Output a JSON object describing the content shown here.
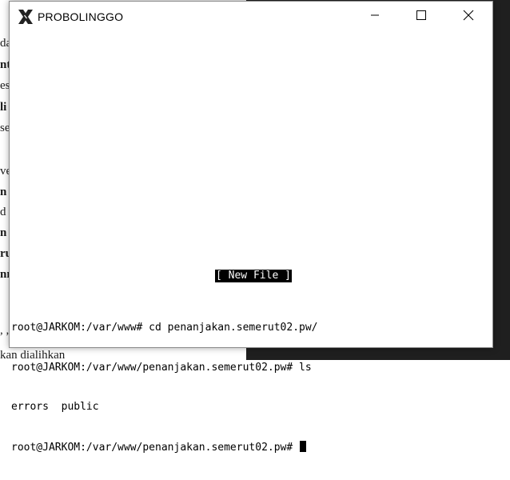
{
  "background": {
    "doc_lines": [
      {
        "text": "da",
        "bold": false
      },
      {
        "text": "nt",
        "bold": true
      },
      {
        "text": "es",
        "bold": false
      },
      {
        "text": "li",
        "bold": true
      },
      {
        "text": "se",
        "bold": false
      },
      {
        "text": "",
        "bold": false
      },
      {
        "text": "ve",
        "bold": false
      },
      {
        "text": "n",
        "bold": true
      },
      {
        "text": "d",
        "bold": false
      },
      {
        "text": "n",
        "bold": true
      },
      {
        "text": "ru",
        "bold": true
      },
      {
        "text": "nn",
        "bold": true
      },
      {
        "text": "",
        "bold": false
      },
      {
        "text": "",
        "bold": false
      },
      {
        "text": ", ,",
        "bold": false
      },
      {
        "text": "kan dialihkan",
        "bold": false
      }
    ]
  },
  "window": {
    "title": "PROBOLINGGO",
    "app_icon": "x-logo-icon",
    "controls": {
      "minimize_icon": "minimize-icon",
      "maximize_icon": "maximize-icon",
      "close_icon": "close-icon"
    }
  },
  "terminal": {
    "status_message": "[ New File ]",
    "lines": [
      "root@JARKOM:/var/www# cd penanjakan.semerut02.pw/",
      "root@JARKOM:/var/www/penanjakan.semerut02.pw# ls",
      "errors  public",
      "root@JARKOM:/var/www/penanjakan.semerut02.pw# "
    ]
  }
}
